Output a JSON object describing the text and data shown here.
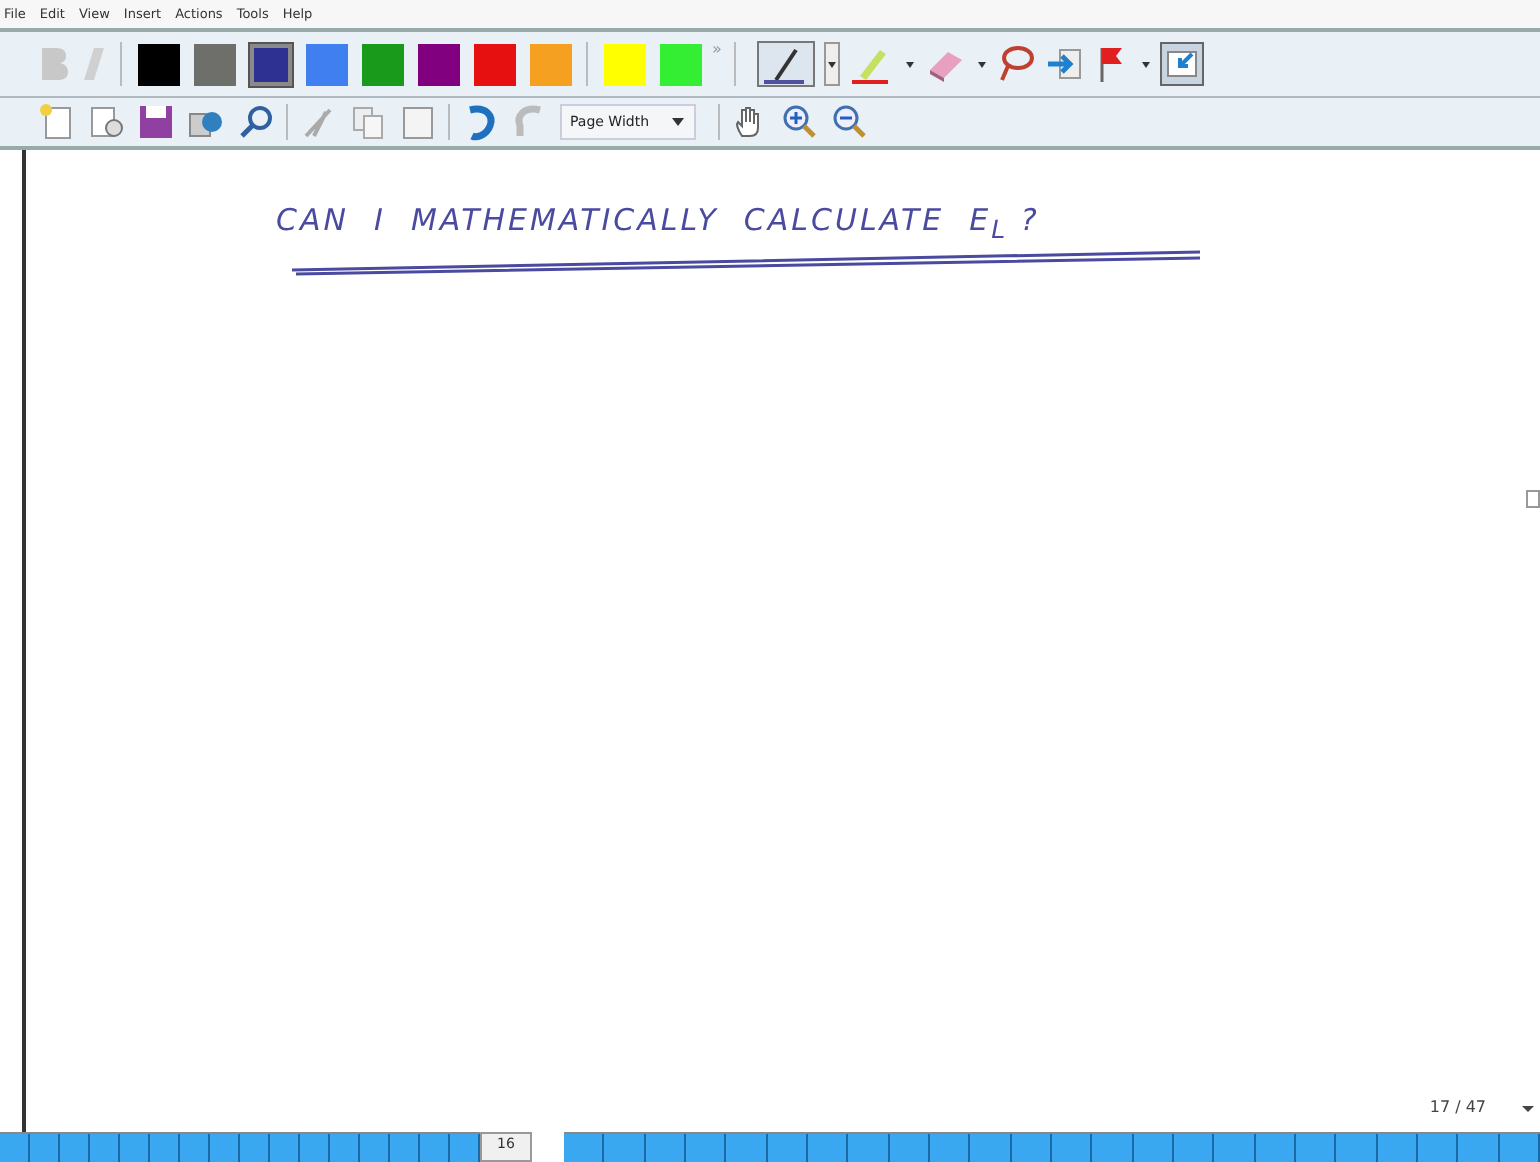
{
  "menu": [
    "File",
    "Edit",
    "View",
    "Insert",
    "Actions",
    "Tools",
    "Help"
  ],
  "swatches": [
    {
      "color": "#000000",
      "selected": false
    },
    {
      "color": "#6e6e6a",
      "selected": false
    },
    {
      "color": "#2e3192",
      "selected": true
    },
    {
      "color": "#3f7ff0",
      "selected": false
    },
    {
      "color": "#1a9a1a",
      "selected": false
    },
    {
      "color": "#800080",
      "selected": false
    },
    {
      "color": "#e61010",
      "selected": false
    },
    {
      "color": "#f5a020",
      "selected": false
    },
    {
      "color": "#ffff00",
      "selected": false
    },
    {
      "color": "#33ee33",
      "selected": false
    }
  ],
  "overflow": "»",
  "zoom_select": {
    "value": "Page Width"
  },
  "note": {
    "text": "CAN  I  MATHEMATICALLY  CALCULATE  E$_{L}$ ?"
  },
  "page_counter": "17 / 47",
  "thumbnail_label": "16"
}
